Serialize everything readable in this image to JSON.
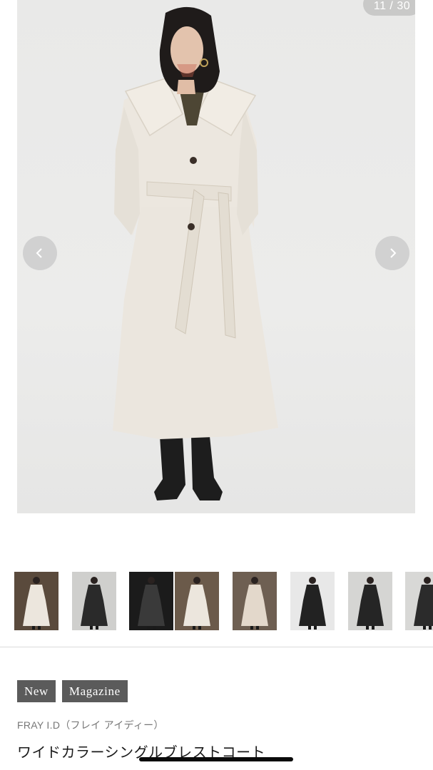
{
  "gallery": {
    "counter": "11 / 30",
    "prev_icon": "chevron-left-icon",
    "next_icon": "chevron-right-icon",
    "thumbnails": [
      {
        "bg": "#5a4a3c",
        "coat": "#ece6dd"
      },
      {
        "bg": "#cfcfcd",
        "coat": "#2a2a2a"
      },
      {
        "bg": "#1b1b1b",
        "coat": "#3a3a3a"
      },
      {
        "bg": "#6b5a4a",
        "coat": "#ece6dd"
      },
      {
        "bg": "#6e5f52",
        "coat": "#e3d8cb"
      },
      {
        "bg": "#e8e8e8",
        "coat": "#222222"
      },
      {
        "bg": "#d5d5d3",
        "coat": "#252525"
      },
      {
        "bg": "#d8d8d6",
        "coat": "#2b2b2b"
      }
    ]
  },
  "tags": [
    "New",
    "Magazine"
  ],
  "product": {
    "brand": "FRAY I.D（フレイ アイディー）",
    "title": "ワイドカラーシングルブレストコート"
  },
  "colors": {
    "tag_bg": "#5b5b5b",
    "coat": "#ebe6de",
    "background": "#e9e9e8"
  }
}
